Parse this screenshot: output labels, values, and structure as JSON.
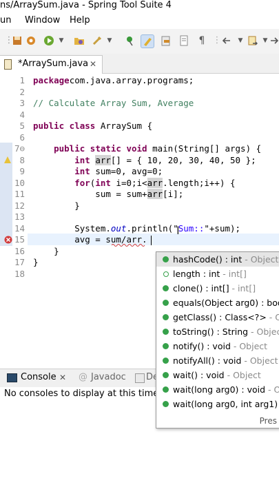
{
  "window": {
    "title": "ns/ArraySum.java - Spring Tool Suite 4"
  },
  "menu": {
    "items": [
      "un",
      "Window",
      "Help"
    ]
  },
  "editor_tab": {
    "label": "*ArraySum.java",
    "close": "✕"
  },
  "code_lines": [
    {
      "n": "1",
      "parts": [
        [
          "kw",
          "package"
        ],
        [
          "",
          "com.java.array.programs;"
        ]
      ]
    },
    {
      "n": "2",
      "parts": []
    },
    {
      "n": "3",
      "parts": [
        [
          "cm",
          "// Calculate Array Sum, Average"
        ]
      ]
    },
    {
      "n": "4",
      "parts": []
    },
    {
      "n": "5",
      "parts": [
        [
          "kw",
          "public class"
        ],
        [
          "",
          " ArraySum {"
        ]
      ]
    },
    {
      "n": "6",
      "parts": []
    },
    {
      "n": "7⊖",
      "parts": [
        [
          "",
          "    "
        ],
        [
          "kw",
          "public static void"
        ],
        [
          "",
          " main(String[] args) {"
        ]
      ]
    },
    {
      "n": "8",
      "parts": [
        [
          "",
          "        "
        ],
        [
          "kw",
          "int"
        ],
        [
          "",
          " "
        ],
        [
          "hl",
          "arr"
        ],
        [
          "",
          "[] = { 10, 20, 30, 40, 50 };"
        ]
      ]
    },
    {
      "n": "9",
      "parts": [
        [
          "",
          "        "
        ],
        [
          "kw",
          "int"
        ],
        [
          "",
          " sum=0, avg=0;"
        ]
      ]
    },
    {
      "n": "10",
      "parts": [
        [
          "",
          "        "
        ],
        [
          "kw",
          "for"
        ],
        [
          "",
          "("
        ],
        [
          "kw",
          "int"
        ],
        [
          "",
          " i=0;i<"
        ],
        [
          "hl",
          "arr"
        ],
        [
          "",
          ".length;i++) {"
        ]
      ]
    },
    {
      "n": "11",
      "parts": [
        [
          "",
          "            sum = sum+"
        ],
        [
          "hl",
          "arr"
        ],
        [
          "",
          "[i];"
        ]
      ]
    },
    {
      "n": "12",
      "parts": [
        [
          "",
          "        }"
        ]
      ]
    },
    {
      "n": "13",
      "parts": []
    },
    {
      "n": "14",
      "parts": [
        [
          "",
          "        System."
        ],
        [
          "fld",
          "out"
        ],
        [
          "",
          ".println(\""
        ],
        [
          "str",
          "Sum::"
        ],
        [
          "",
          "\"+sum);"
        ]
      ]
    },
    {
      "n": "15",
      "parts": [
        [
          "",
          "        avg = sum/arr."
        ]
      ]
    },
    {
      "n": "16",
      "parts": [
        [
          "",
          "    }"
        ]
      ]
    },
    {
      "n": "17",
      "parts": [
        [
          "",
          "}"
        ]
      ]
    },
    {
      "n": "18",
      "parts": []
    }
  ],
  "console": {
    "tab_label": "Console",
    "tab_close": "✕",
    "javadoc_label": "Javadoc",
    "third_label": "De",
    "message": "No consoles to display at this time."
  },
  "completion": {
    "items": [
      {
        "name": "hashCode() : int",
        "type": " - Object",
        "hollow": false
      },
      {
        "name": "length : int",
        "type": " - int[]",
        "hollow": true
      },
      {
        "name": "clone() : int[]",
        "type": " - int[]",
        "hollow": false
      },
      {
        "name": "equals(Object arg0) : boo",
        "type": "",
        "hollow": false
      },
      {
        "name": "getClass() : Class<?>",
        "type": " - Obje",
        "hollow": false
      },
      {
        "name": "toString() : String",
        "type": " - Objec",
        "hollow": false
      },
      {
        "name": "notify() : void",
        "type": " - Object",
        "hollow": false
      },
      {
        "name": "notifyAll() : void",
        "type": " - Object",
        "hollow": false
      },
      {
        "name": "wait() : void",
        "type": " - Object",
        "hollow": false
      },
      {
        "name": "wait(long arg0) : void",
        "type": " - O",
        "hollow": false
      },
      {
        "name": "wait(long arg0, int arg1) :",
        "type": "",
        "hollow": false
      }
    ],
    "footer": "Pres"
  },
  "colors": {
    "keyword": "#7f0055",
    "comment": "#3f7f5f",
    "string": "#2a00ff",
    "method_dot": "#36a14a"
  },
  "icons": [
    "save-icon",
    "gear-icon",
    "run-icon",
    "folder-open-icon",
    "wrench-icon",
    "pin-icon",
    "highlight-icon",
    "link-icon",
    "document-icon",
    "paragraph-icon",
    "back-icon",
    "forward-icon"
  ]
}
